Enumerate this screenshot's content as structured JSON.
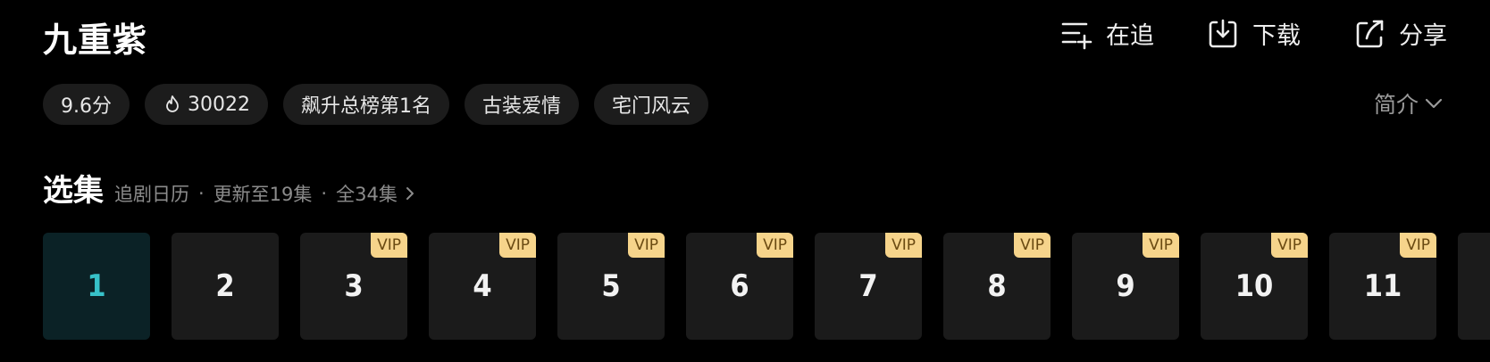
{
  "title": "九重紫",
  "actions": {
    "follow": "在追",
    "download": "下载",
    "share": "分享"
  },
  "tags": {
    "rating": "9.6分",
    "heat": "30022",
    "rank": "飙升总榜第1名",
    "genre": "古装爱情",
    "theme": "宅门风云"
  },
  "intro_label": "简介",
  "selection": {
    "title": "选集",
    "calendar": "追剧日历",
    "updated": "更新至19集",
    "total": "全34集",
    "separator": "·"
  },
  "episodes": [
    {
      "num": "1",
      "vip": "",
      "active": true
    },
    {
      "num": "2",
      "vip": ""
    },
    {
      "num": "3",
      "vip": "VIP"
    },
    {
      "num": "4",
      "vip": "VIP"
    },
    {
      "num": "5",
      "vip": "VIP"
    },
    {
      "num": "6",
      "vip": "VIP"
    },
    {
      "num": "7",
      "vip": "VIP"
    },
    {
      "num": "8",
      "vip": "VIP"
    },
    {
      "num": "9",
      "vip": "VIP"
    },
    {
      "num": "10",
      "vip": "VIP"
    },
    {
      "num": "11",
      "vip": "VIP"
    }
  ],
  "colors": {
    "background": "#000000",
    "chip": "#1c1c1c",
    "active_episode_text": "#37c2c9",
    "vip_badge": "#f6d48b"
  }
}
